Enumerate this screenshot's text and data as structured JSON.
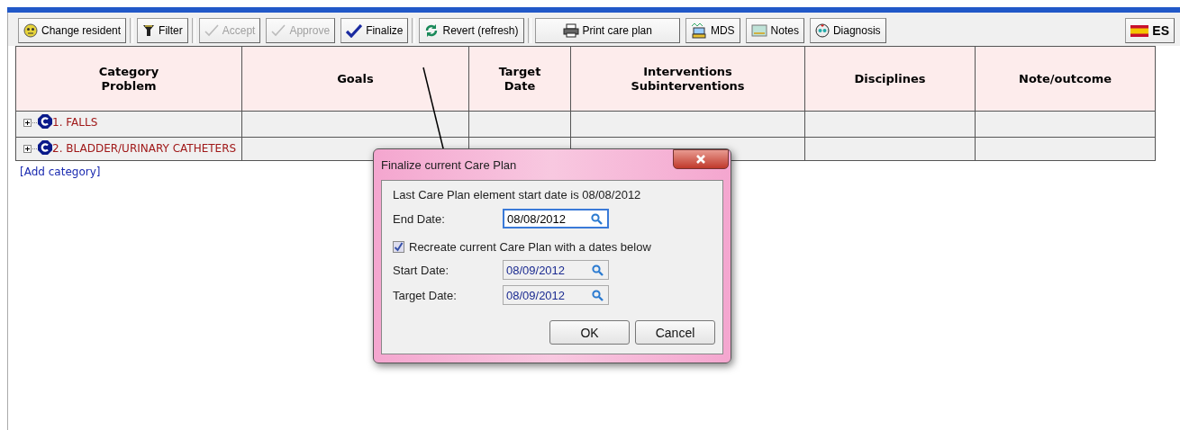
{
  "toolbar": {
    "buttons": [
      {
        "label": "Change resident",
        "disabled": false
      },
      {
        "label": "Filter",
        "disabled": false
      },
      {
        "label": "Accept",
        "disabled": true
      },
      {
        "label": "Approve",
        "disabled": true
      },
      {
        "label": "Finalize",
        "disabled": false
      },
      {
        "label": "Revert (refresh)",
        "disabled": false
      },
      {
        "label": "Print care plan",
        "disabled": false
      },
      {
        "label": "MDS",
        "disabled": false
      },
      {
        "label": "Notes",
        "disabled": false
      },
      {
        "label": "Diagnosis",
        "disabled": false
      }
    ],
    "language": "ES"
  },
  "table": {
    "columns": [
      {
        "lines": [
          "Category",
          "Problem"
        ]
      },
      {
        "lines": [
          "Goals"
        ]
      },
      {
        "lines": [
          "Target",
          "Date"
        ]
      },
      {
        "lines": [
          "Interventions",
          "Subinterventions"
        ]
      },
      {
        "lines": [
          "Disciplines"
        ]
      },
      {
        "lines": [
          "Note/outcome"
        ]
      }
    ],
    "rows": [
      {
        "category": "1. FALLS",
        "expanded": false
      },
      {
        "category": "2. BLADDER/URINARY CATHETERS",
        "expanded": false
      }
    ],
    "add_link": "[Add category]"
  },
  "dialog": {
    "title": "Finalize current Care Plan",
    "info": "Last Care Plan element start date is 08/08/2012",
    "end_date": {
      "label": "End Date:",
      "value": "08/08/2012",
      "focused": true
    },
    "recreate": {
      "label": "Recreate current Care Plan with a dates below",
      "checked": true
    },
    "start_date": {
      "label": "Start Date:",
      "value": "08/09/2012",
      "focused": false
    },
    "target_date": {
      "label": "Target Date:",
      "value": "08/09/2012",
      "focused": false
    },
    "buttons": [
      "OK",
      "Cancel"
    ]
  }
}
